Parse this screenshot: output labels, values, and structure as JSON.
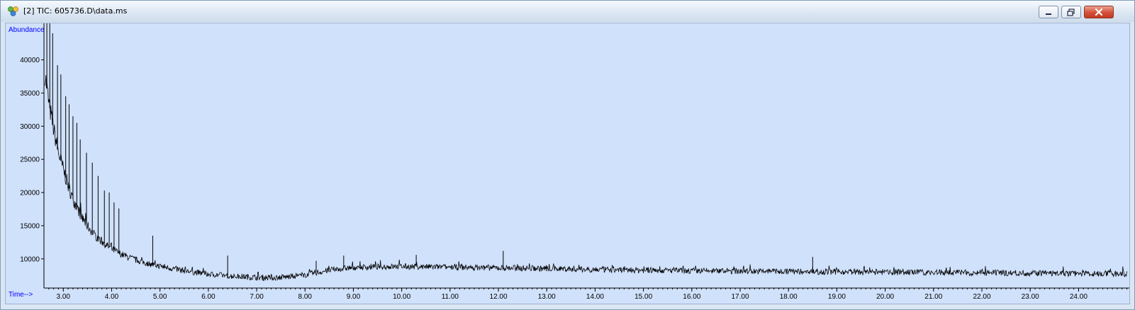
{
  "window": {
    "title": "[2] TIC: 605736.D\\data.ms",
    "controls": [
      "minimize",
      "restore",
      "close"
    ]
  },
  "colors": {
    "plot_background": "#d0e1fb",
    "trace": "#000000",
    "axis_label": "#0000ff",
    "close_button": "#d3503a"
  },
  "icons": {
    "app": "chromatogram-app-icon"
  },
  "chart_data": {
    "type": "line",
    "ylabel": "Abundance",
    "xlabel": "Time-->",
    "xlim": [
      2.6,
      25.05
    ],
    "ylim": [
      5600,
      45500
    ],
    "x_ticks": [
      "3.00",
      "4.00",
      "5.00",
      "6.00",
      "7.00",
      "8.00",
      "9.00",
      "10.00",
      "11.00",
      "12.00",
      "13.00",
      "14.00",
      "15.00",
      "16.00",
      "17.00",
      "18.00",
      "19.00",
      "20.00",
      "21.00",
      "22.00",
      "23.00",
      "24.00"
    ],
    "y_ticks": [
      "10000",
      "15000",
      "20000",
      "25000",
      "30000",
      "35000",
      "40000"
    ],
    "series": [
      {
        "x": [
          2.62,
          2.7,
          2.8,
          2.9,
          3.0,
          3.1,
          3.2,
          3.3,
          3.4,
          3.5,
          3.6,
          3.7,
          3.8,
          3.9,
          4.0,
          4.2,
          4.4,
          4.6,
          4.8,
          5.0,
          5.3,
          5.6,
          6.0,
          6.5,
          7.0,
          7.3,
          7.6,
          8.0,
          8.3,
          8.6,
          9.0,
          9.5,
          10.0,
          10.5,
          11.0,
          11.5,
          12.0,
          13.0,
          14.0,
          15.0,
          16.0,
          17.0,
          18.0,
          19.0,
          20.0,
          21.0,
          22.0,
          23.0,
          24.0,
          25.0
        ],
        "y": [
          38000,
          33500,
          29500,
          26000,
          23500,
          21000,
          19000,
          17500,
          16000,
          15000,
          14000,
          13200,
          12600,
          12000,
          11500,
          10700,
          10100,
          9600,
          9200,
          8900,
          8500,
          8100,
          7700,
          7400,
          7200,
          7150,
          7250,
          7600,
          8000,
          8400,
          8700,
          8800,
          8850,
          8800,
          8750,
          8700,
          8650,
          8550,
          8400,
          8300,
          8200,
          8150,
          8100,
          8050,
          8000,
          7950,
          7900,
          7850,
          7800,
          7750
        ]
      }
    ],
    "peaks": [
      {
        "x": 2.66,
        "y": 45500
      },
      {
        "x": 2.72,
        "y": 45500
      },
      {
        "x": 2.78,
        "y": 44000
      },
      {
        "x": 2.88,
        "y": 39200
      },
      {
        "x": 2.95,
        "y": 37800
      },
      {
        "x": 3.05,
        "y": 34500
      },
      {
        "x": 3.12,
        "y": 33300
      },
      {
        "x": 3.2,
        "y": 31500
      },
      {
        "x": 3.28,
        "y": 30500
      },
      {
        "x": 3.35,
        "y": 28000
      },
      {
        "x": 3.48,
        "y": 26000
      },
      {
        "x": 3.6,
        "y": 24500
      },
      {
        "x": 3.72,
        "y": 22500
      },
      {
        "x": 3.85,
        "y": 20300
      },
      {
        "x": 3.95,
        "y": 20000
      },
      {
        "x": 4.05,
        "y": 18500
      },
      {
        "x": 4.15,
        "y": 17600
      },
      {
        "x": 4.85,
        "y": 13500
      },
      {
        "x": 6.4,
        "y": 10500
      },
      {
        "x": 8.23,
        "y": 9700
      },
      {
        "x": 8.8,
        "y": 10500
      },
      {
        "x": 10.3,
        "y": 10600
      },
      {
        "x": 12.1,
        "y": 11200
      },
      {
        "x": 18.5,
        "y": 10300
      }
    ]
  }
}
